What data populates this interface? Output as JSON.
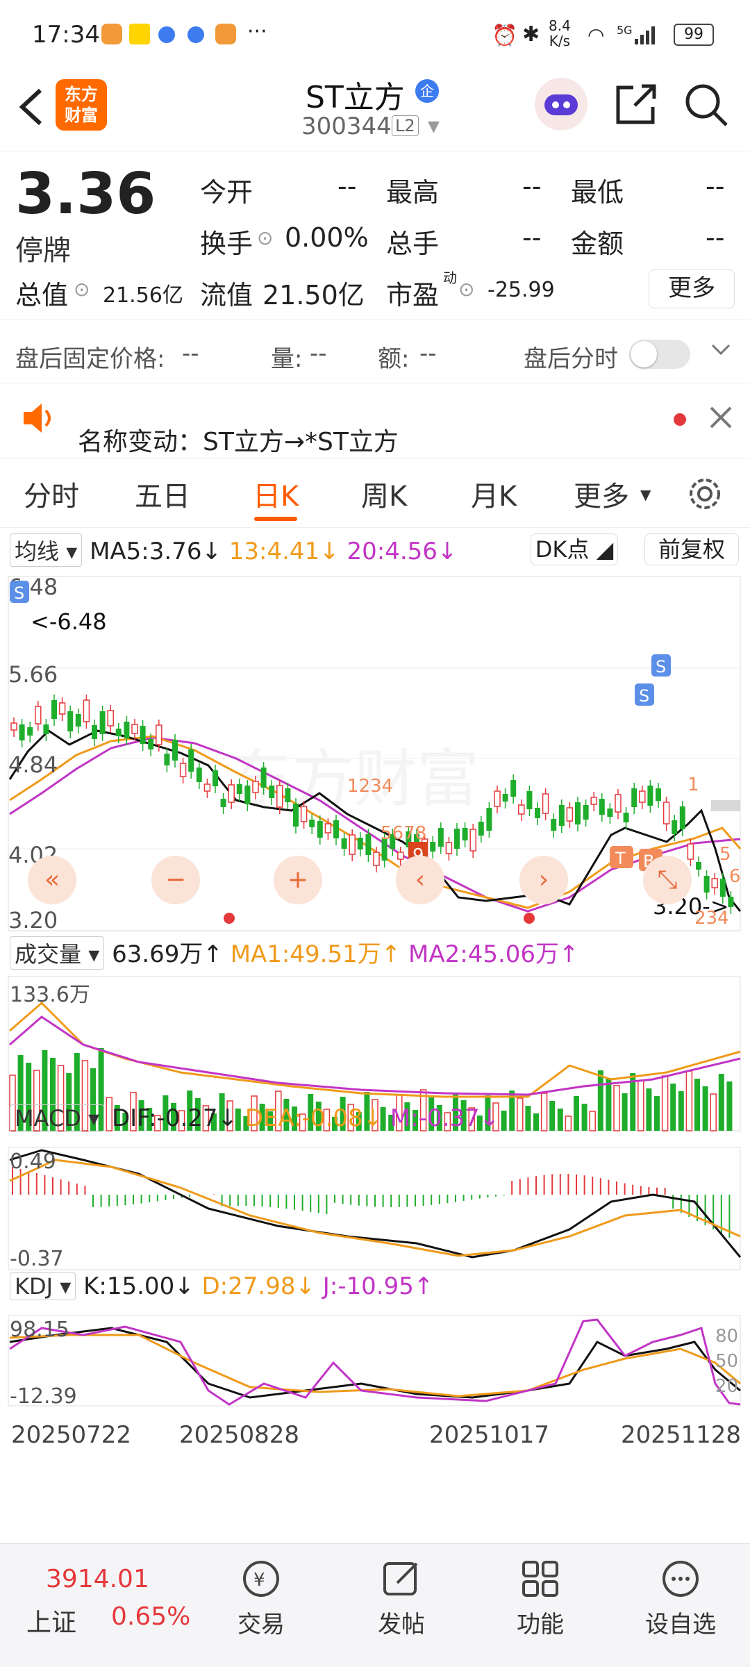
{
  "status": {
    "time": "17:34",
    "dots": "···",
    "net_speed_top": "8.4",
    "net_speed_bottom": "K/s",
    "signal_label": "5G",
    "battery": "99"
  },
  "header": {
    "back_icon": "chevron-left-icon",
    "logo_line1": "东方",
    "logo_line2": "财富",
    "stock_name": "ST立方",
    "enterprise_badge": "企",
    "stock_code": "300344",
    "level": "L2"
  },
  "quote": {
    "price": "3.36",
    "status": "停牌",
    "open_label": "今开",
    "open_value": "--",
    "high_label": "最高",
    "high_value": "--",
    "low_label": "最低",
    "low_value": "--",
    "turnover_label": "换手",
    "turnover_value": "0.00%",
    "volume_label": "总手",
    "volume_value": "--",
    "amount_label": "金额",
    "amount_value": "--",
    "mktcap_label": "总值",
    "mktcap_value": "21.56亿",
    "float_label": "流值",
    "float_value": "21.50亿",
    "pe_label": "市盈",
    "pe_sup": "动",
    "pe_value": "-25.99",
    "more_button": "更多"
  },
  "after_hours": {
    "fixed_price_label": "盘后固定价格:",
    "fixed_price_value": "--",
    "vol_label": "量:",
    "vol_value": "--",
    "amt_label": "额:",
    "amt_value": "--",
    "timeshare_label": "盘后分时"
  },
  "notice": {
    "text": "名称变动：ST立方→*ST立方"
  },
  "tabs": [
    {
      "label": "分时"
    },
    {
      "label": "五日"
    },
    {
      "label": "日K",
      "active": true
    },
    {
      "label": "周K"
    },
    {
      "label": "月K"
    },
    {
      "label": "更多"
    }
  ],
  "kline": {
    "indicator_select": "均线",
    "ma5": "MA5:3.76↓",
    "ma13": "13:4.41↓",
    "ma20": "20:4.56↓",
    "dk_button": "DK点",
    "adjust_button": "前复权",
    "y_top": "6.48",
    "y_max_annot": "<-6.48",
    "y2": "5.66",
    "y3": "4.84",
    "y4": "4.02",
    "y_bottom": "3.20",
    "y_min_annot": "3.20->",
    "watermark": "东方财富",
    "markers": {
      "s": "S",
      "t": "T",
      "b": "B",
      "nine": "9",
      "seq1": "1234",
      "seq2": "5678",
      "seq3": "234",
      "seq_one": "1",
      "seq_five": "5",
      "seq_six": "6"
    }
  },
  "volume": {
    "select": "成交量",
    "value": "63.69万↑",
    "ma1": "MA1:49.51万↑",
    "ma2": "MA2:45.06万↑",
    "y_top": "133.6万"
  },
  "macd": {
    "select": "MACD",
    "dif": "DIF:-0.27↓",
    "dea": "DEA:-0.08↓",
    "m": "M:-0.37↓",
    "y_top": "0.49",
    "y_bottom": "-0.37"
  },
  "kdj": {
    "select": "KDJ",
    "k": "K:15.00↓",
    "d": "D:27.98↓",
    "j": "J:-10.95↑",
    "y_top": "98.15",
    "y_bottom": "-12.39",
    "r80": "80",
    "r50": "50",
    "r20": "20"
  },
  "dates": [
    "20250722",
    "20250828",
    "20251017",
    "20251128"
  ],
  "bottom_bar": {
    "index_value": "3914.01",
    "index_name": "上证",
    "index_change": "0.65%",
    "trade": "交易",
    "post": "发帖",
    "func": "功能",
    "watchlist": "设自选"
  },
  "colors": {
    "up": "#e5383b",
    "down": "#1fae2c",
    "ma5": "#111111",
    "ma13": "#f09a1a",
    "ma20": "#c234c6",
    "brand": "#ff6a00"
  }
}
